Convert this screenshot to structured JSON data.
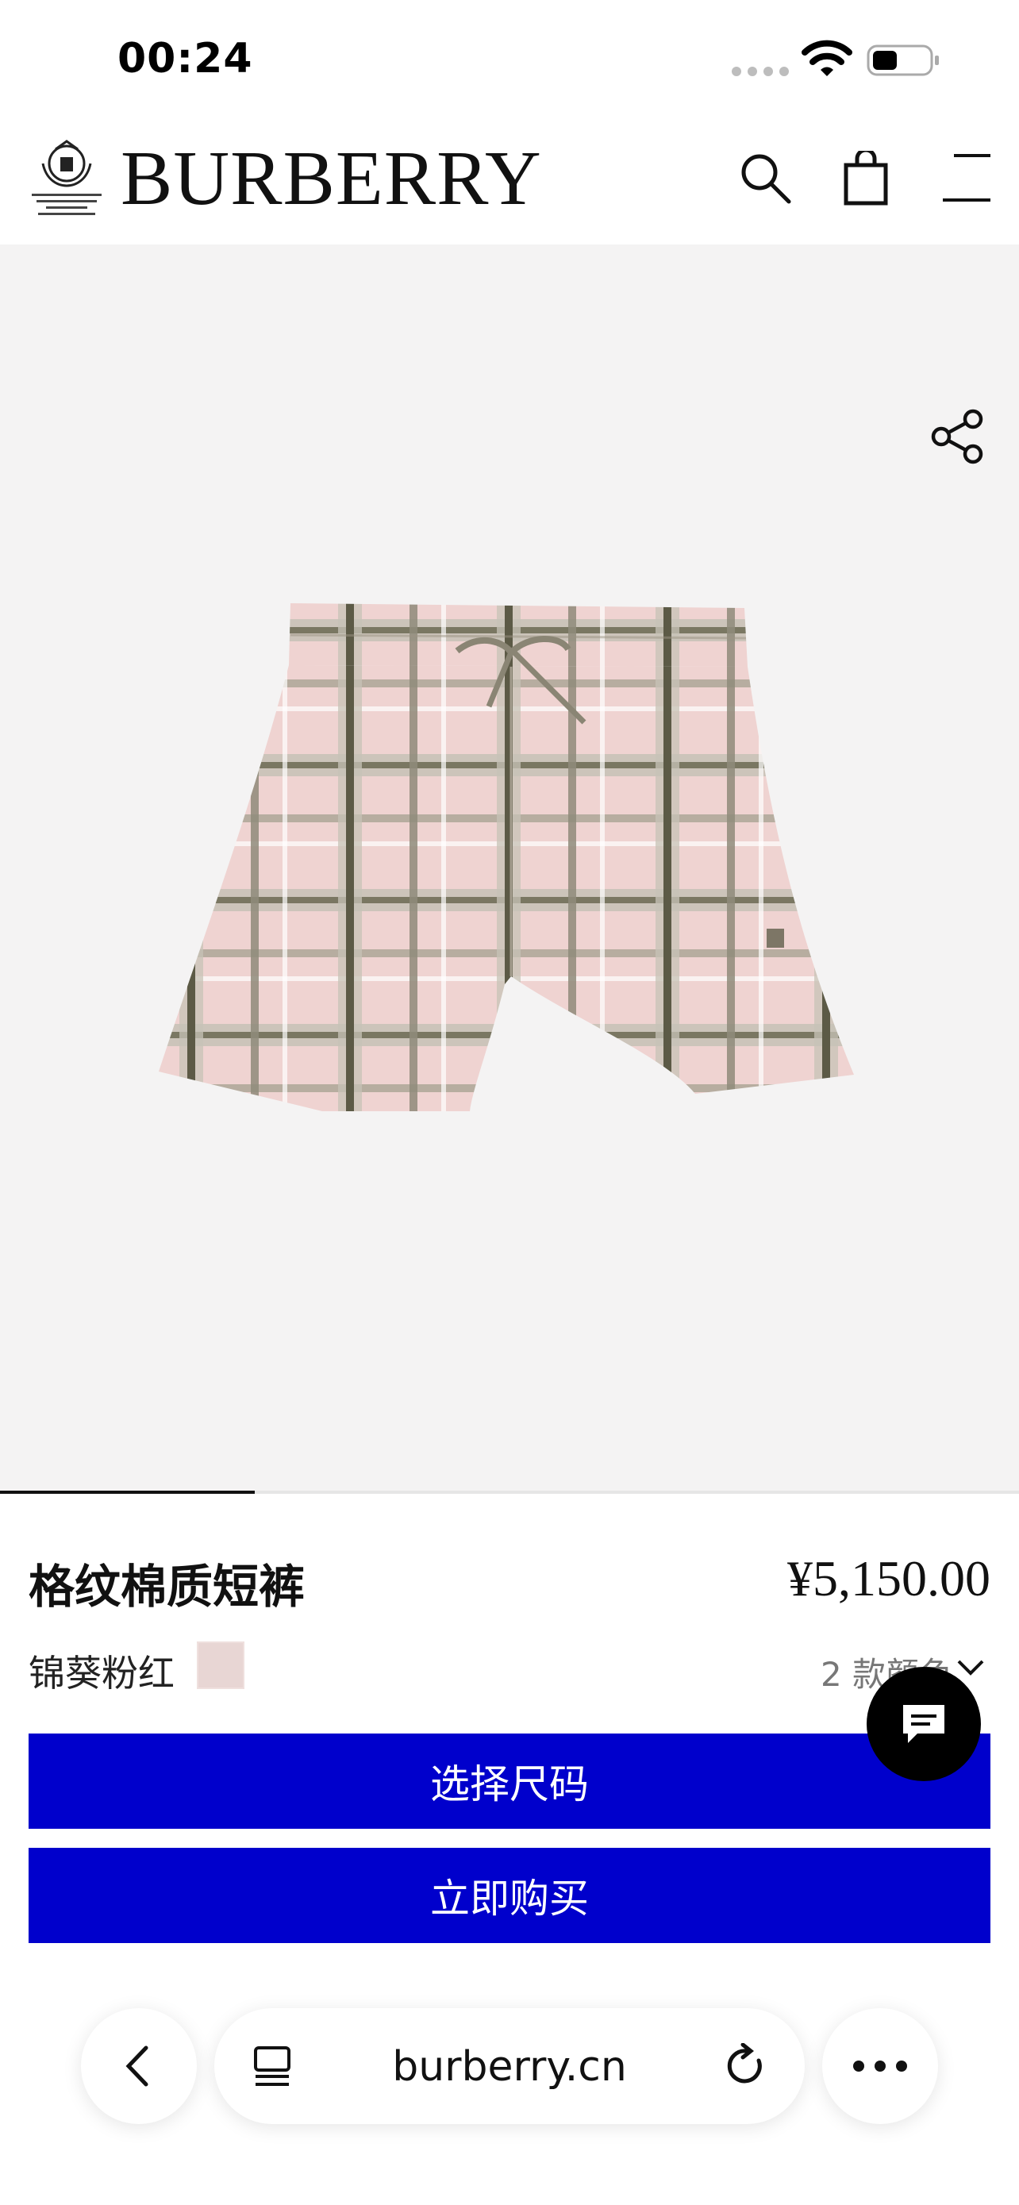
{
  "status_bar": {
    "time": "00:24"
  },
  "header": {
    "brand": "BURBERRY",
    "crest_text": "BY APPOINTMENT TO HIS MAJESTY KING CHARLES III OUTFITTERS BURBERRY LIMITED LONDON",
    "icons": [
      "search-icon",
      "shopping-bag-icon",
      "menu-icon"
    ]
  },
  "gallery": {
    "share_icon": "share-icon",
    "image_progress": 0.25
  },
  "product": {
    "title": "格纹棉质短裤",
    "price": "¥5,150.00",
    "color_name": "锦葵粉红",
    "swatch_color": "#e8d6d4",
    "colors_count": "2 款颜色"
  },
  "actions": {
    "select_size": "选择尺码",
    "buy_now": "立即购买",
    "accent_color": "#0000cc"
  },
  "browser": {
    "url": "burberry.cn"
  }
}
